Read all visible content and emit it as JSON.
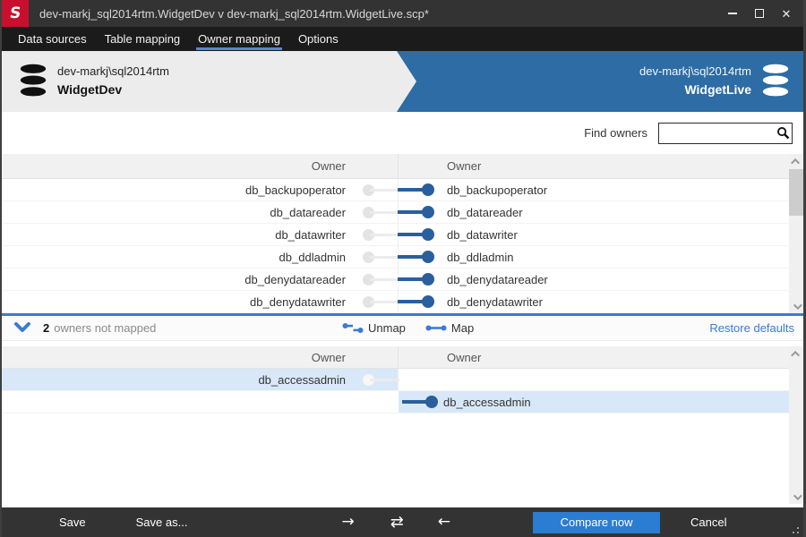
{
  "window": {
    "title": "dev-markj_sql2014rtm.WidgetDev v dev-markj_sql2014rtm.WidgetLive.scp*"
  },
  "menu": {
    "items": [
      {
        "label": "Data sources"
      },
      {
        "label": "Table mapping"
      },
      {
        "label": "Owner mapping"
      },
      {
        "label": "Options"
      }
    ],
    "active": "Owner mapping"
  },
  "sources": {
    "left": {
      "server": "dev-markj\\sql2014rtm",
      "database": "WidgetDev"
    },
    "right": {
      "server": "dev-markj\\sql2014rtm",
      "database": "WidgetLive"
    }
  },
  "search": {
    "label": "Find owners",
    "value": ""
  },
  "mapped_grid": {
    "left_header": "Owner",
    "right_header": "Owner",
    "rows": [
      {
        "left": "db_backupoperator",
        "right": "db_backupoperator"
      },
      {
        "left": "db_datareader",
        "right": "db_datareader"
      },
      {
        "left": "db_datawriter",
        "right": "db_datawriter"
      },
      {
        "left": "db_ddladmin",
        "right": "db_ddladmin"
      },
      {
        "left": "db_denydatareader",
        "right": "db_denydatareader"
      },
      {
        "left": "db_denydatawriter",
        "right": "db_denydatawriter"
      }
    ]
  },
  "divider": {
    "count": "2",
    "label": "owners not mapped",
    "unmap": "Unmap",
    "map": "Map",
    "restore": "Restore defaults"
  },
  "unmapped_grid": {
    "left_header": "Owner",
    "right_header": "Owner",
    "left_owner": "db_accessadmin",
    "right_owner": "db_accessadmin"
  },
  "footer": {
    "save": "Save",
    "save_as": "Save as...",
    "compare": "Compare now",
    "cancel": "Cancel"
  },
  "colors": {
    "titlebar": "#333333",
    "logo_red": "#c8102e",
    "header_blue": "#2d6ca4",
    "link_blue": "#3a7bd5",
    "slider_blue": "#2a5f9e",
    "selection_blue": "#d9e8f8",
    "compare_button_blue": "#2b7cd3"
  }
}
